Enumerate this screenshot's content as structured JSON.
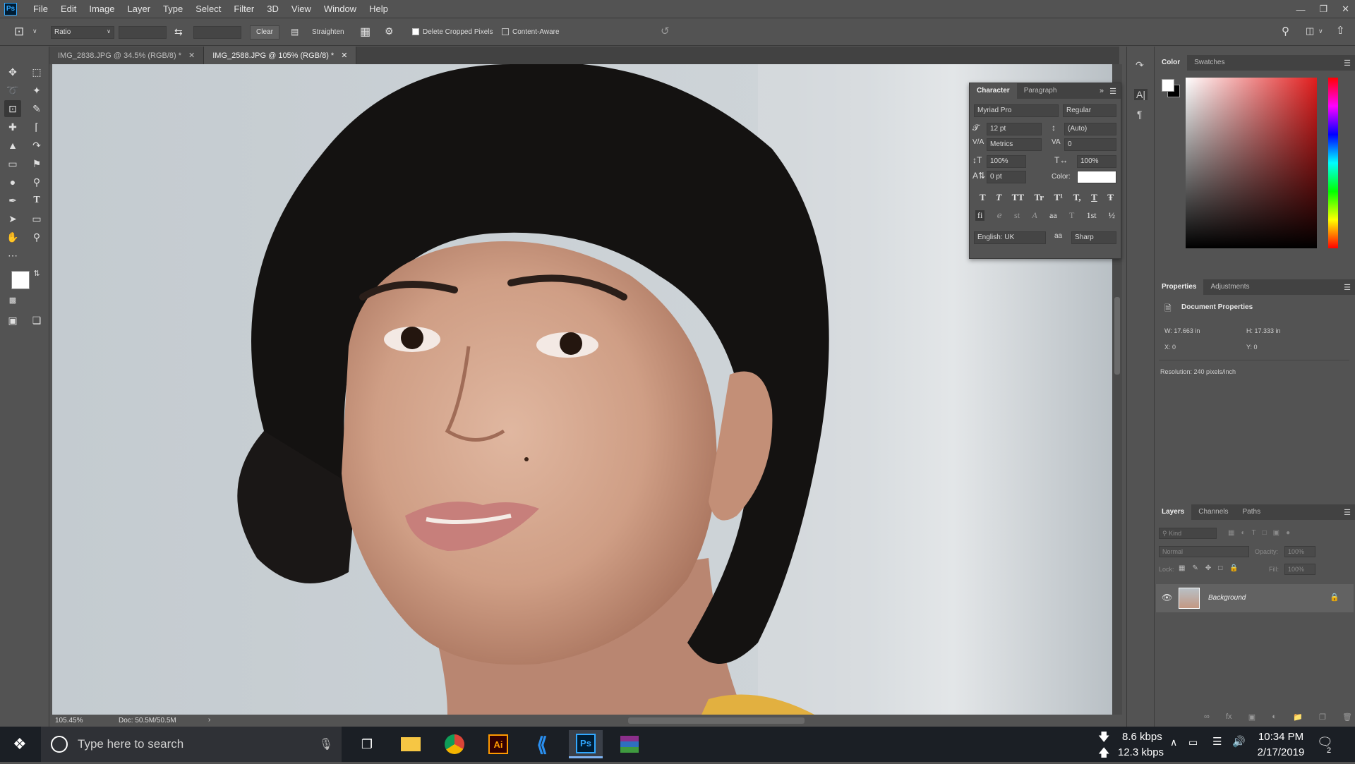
{
  "menu": [
    "File",
    "Edit",
    "Image",
    "Layer",
    "Type",
    "Select",
    "Filter",
    "3D",
    "View",
    "Window",
    "Help"
  ],
  "options": {
    "ratio": "Ratio",
    "clear": "Clear",
    "straighten": "Straighten",
    "delete_cropped": "Delete Cropped Pixels",
    "content_aware": "Content-Aware"
  },
  "tabs": [
    {
      "label": "IMG_2838.JPG @ 34.5% (RGB/8) *"
    },
    {
      "label": "IMG_2588.JPG @ 105% (RGB/8) *"
    }
  ],
  "status": {
    "zoom": "105.45%",
    "doc": "Doc: 50.5M/50.5M"
  },
  "character": {
    "tab_char": "Character",
    "tab_para": "Paragraph",
    "font": "Myriad Pro",
    "style": "Regular",
    "size": "12 pt",
    "leading": "(Auto)",
    "kerning": "Metrics",
    "tracking": "0",
    "vscale": "100%",
    "hscale": "100%",
    "baseline": "0 pt",
    "color_label": "Color:",
    "language": "English: UK",
    "aa": "Sharp",
    "style_glyphs": [
      "T",
      "T",
      "TT",
      "Tr",
      "T¹",
      "T,",
      "T",
      "Ŧ"
    ],
    "ot_glyphs": [
      "fi",
      "ℯ",
      "st",
      "A",
      "aa",
      "T",
      "1st",
      "½"
    ]
  },
  "color_panel": {
    "tab_color": "Color",
    "tab_swatches": "Swatches"
  },
  "properties": {
    "tab_props": "Properties",
    "tab_adj": "Adjustments",
    "title": "Document Properties",
    "w": "W:  17.663 in",
    "h": "H:  17.333 in",
    "x": "X:  0",
    "y": "Y:  0",
    "resolution": "Resolution: 240 pixels/inch"
  },
  "layers": {
    "tab_layers": "Layers",
    "tab_channels": "Channels",
    "tab_paths": "Paths",
    "kind": "Kind",
    "blend": "Normal",
    "opacity_label": "Opacity:",
    "opacity": "100%",
    "lock_label": "Lock:",
    "fill_label": "Fill:",
    "fill": "100%",
    "layer_name": "Background"
  },
  "taskbar": {
    "search_placeholder": "Type here to search",
    "net_down": "8.6 kbps",
    "net_up": "12.3 kbps",
    "time": "10:34 PM",
    "date": "2/17/2019",
    "notif_count": "2"
  },
  "colors": {
    "ps_bg": "#535353",
    "accent": "#31a8ff",
    "taskbar": "#1b1f25"
  }
}
